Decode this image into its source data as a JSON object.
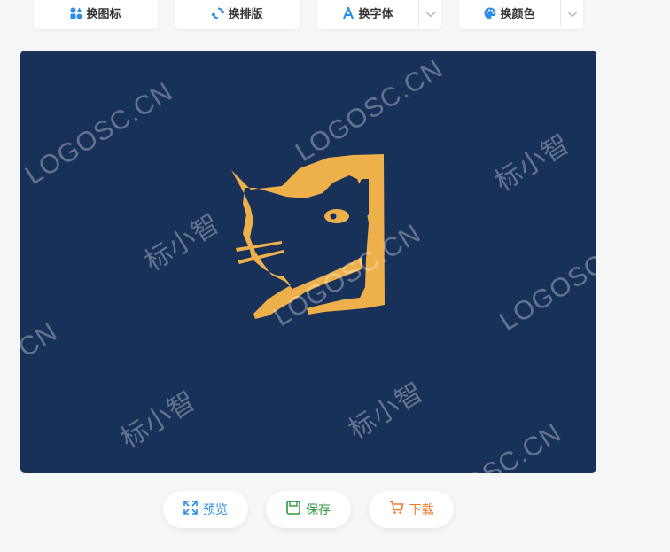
{
  "toolbar": {
    "change_icon": "换图标",
    "change_layout": "换排版",
    "change_font": "换字体",
    "change_color": "换颜色"
  },
  "canvas": {
    "background_color": "#183158",
    "logo_color": "#edb04b",
    "watermarks": [
      "LOGOSC.CN",
      "LOGOSC.CN",
      "标小智",
      "标小智",
      "LOGOSC.CN",
      "LOGOSC",
      "CN",
      "标小智",
      "标小智",
      "OSC.CN"
    ]
  },
  "actions": {
    "preview": "预览",
    "save": "保存",
    "download": "下载"
  },
  "colors": {
    "preview": "#2b8de8",
    "save": "#2e9a40",
    "download": "#ef7a2e"
  }
}
